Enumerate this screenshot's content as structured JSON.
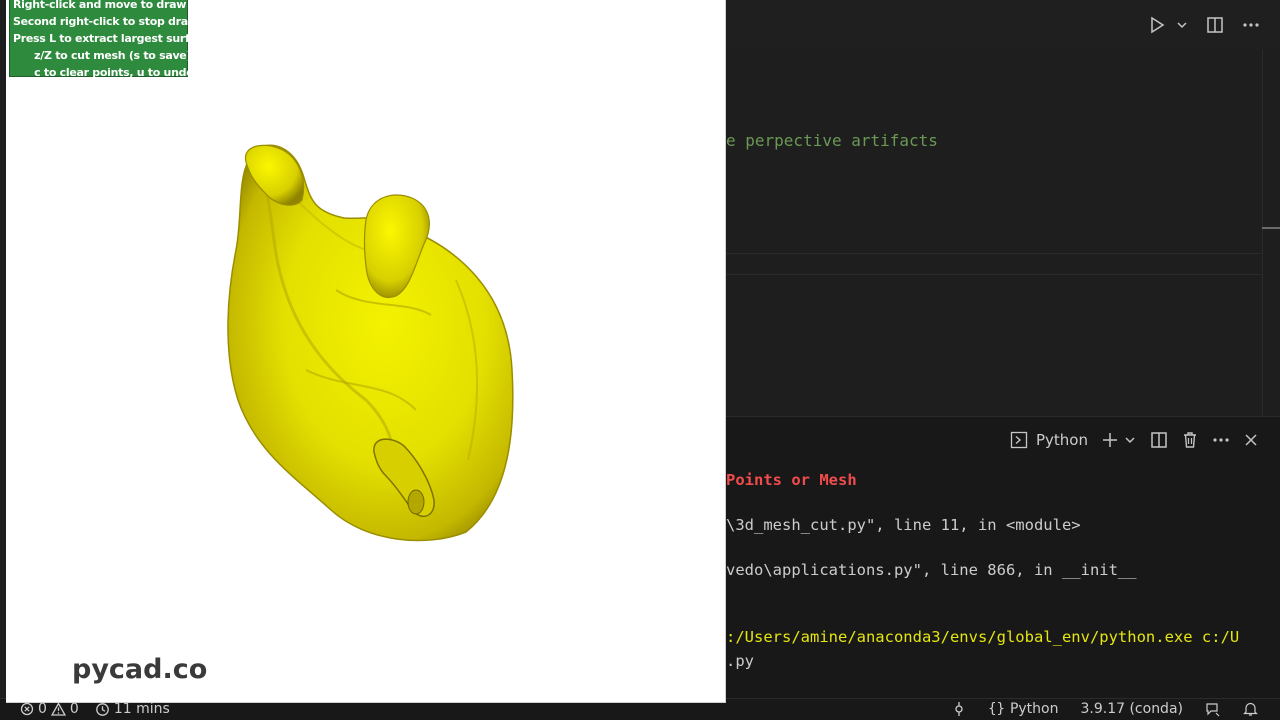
{
  "vedo": {
    "help_lines": [
      "Right-click and move to draw line",
      "Second right-click to stop drawing",
      "Press L to extract largest surface",
      "      z/Z to cut mesh (s to save)",
      "      c to clear points, u to undo"
    ],
    "watermark": "pycad.co",
    "mesh_color": "#e6e600"
  },
  "editor": {
    "code_comment": "e perpective artifacts",
    "colors": {
      "comment": "#6a9955"
    }
  },
  "toolbar_icons": [
    "run-icon",
    "chevron-down-icon",
    "split-editor-icon",
    "more-icon"
  ],
  "panel": {
    "terminal_name": "Python",
    "terminal_lines": [
      {
        "text": "Points or Mesh",
        "style": "red"
      },
      {
        "text": "\\3d_mesh_cut.py\", line 11, in <module>",
        "style": "normal"
      },
      {
        "text": "vedo\\applications.py\", line 866, in __init__",
        "style": "normal"
      },
      {
        "text": ":/Users/amine/anaconda3/envs/global_env/python.exe c:/U",
        "style": "yellow"
      },
      {
        "text": ".py",
        "style": "normal"
      }
    ]
  },
  "statusbar": {
    "errors": "0",
    "warnings": "0",
    "time": "11 mins",
    "language": "Python",
    "interpreter": "3.9.17 (conda)"
  }
}
